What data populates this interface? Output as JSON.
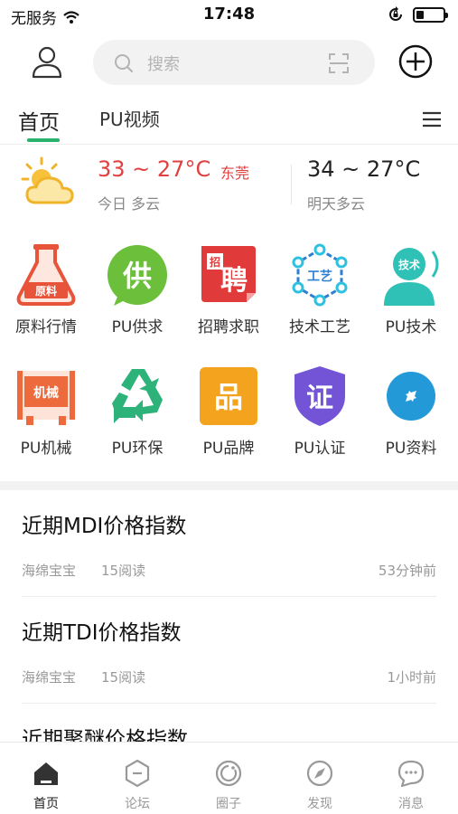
{
  "status_bar": {
    "carrier": "无服务",
    "time": "17:48",
    "battery_level": 0.3
  },
  "search": {
    "placeholder": "搜索"
  },
  "tabs": [
    {
      "label": "首页",
      "active": true
    },
    {
      "label": "PU视频",
      "active": false
    }
  ],
  "weather": {
    "today_temp": "33 ~ 27°C",
    "city": "东莞",
    "today_condition": "今日 多云",
    "tomorrow_temp": "34 ~ 27°C",
    "tomorrow_condition": "明天多云"
  },
  "categories": [
    {
      "label": "原料行情",
      "icon": "flask-icon",
      "icon_text": "原料",
      "color": "#e8543a"
    },
    {
      "label": "PU供求",
      "icon": "supply-icon",
      "icon_text": "供",
      "color": "#6cbf3a"
    },
    {
      "label": "招聘求职",
      "icon": "recruit-icon",
      "icon_text": "聘",
      "icon_subtext": "招",
      "color": "#e03a3a"
    },
    {
      "label": "技术工艺",
      "icon": "craft-icon",
      "icon_text": "工艺",
      "color": "#2f7fd0"
    },
    {
      "label": "PU技术",
      "icon": "tech-icon",
      "icon_text": "技术",
      "color": "#2fc1b6"
    },
    {
      "label": "PU机械",
      "icon": "machine-icon",
      "icon_text": "机械",
      "color": "#ec6a3b"
    },
    {
      "label": "PU环保",
      "icon": "recycle-icon",
      "color": "#2db37a"
    },
    {
      "label": "PU品牌",
      "icon": "brand-icon",
      "icon_text": "品",
      "color": "#f3a31e"
    },
    {
      "label": "PU认证",
      "icon": "certify-icon",
      "icon_text": "证",
      "color": "#7353d6"
    },
    {
      "label": "PU资料",
      "icon": "data-icon",
      "color": "#2499d8"
    }
  ],
  "news": [
    {
      "title": "近期MDI价格指数",
      "author": "海绵宝宝",
      "reads": "15阅读",
      "time": "53分钟前"
    },
    {
      "title": "近期TDI价格指数",
      "author": "海绵宝宝",
      "reads": "15阅读",
      "time": "1小时前"
    },
    {
      "title": "近期聚醚价格指数",
      "author": "",
      "reads": "",
      "time": ""
    }
  ],
  "bottom_nav": [
    {
      "label": "首页",
      "icon": "home-icon",
      "active": true
    },
    {
      "label": "论坛",
      "icon": "forum-icon",
      "active": false
    },
    {
      "label": "圈子",
      "icon": "circle-icon",
      "active": false
    },
    {
      "label": "发现",
      "icon": "discover-icon",
      "active": false
    },
    {
      "label": "消息",
      "icon": "message-icon",
      "active": false
    }
  ],
  "colors": {
    "accent": "#29b36a",
    "warm": "#e0403f"
  }
}
